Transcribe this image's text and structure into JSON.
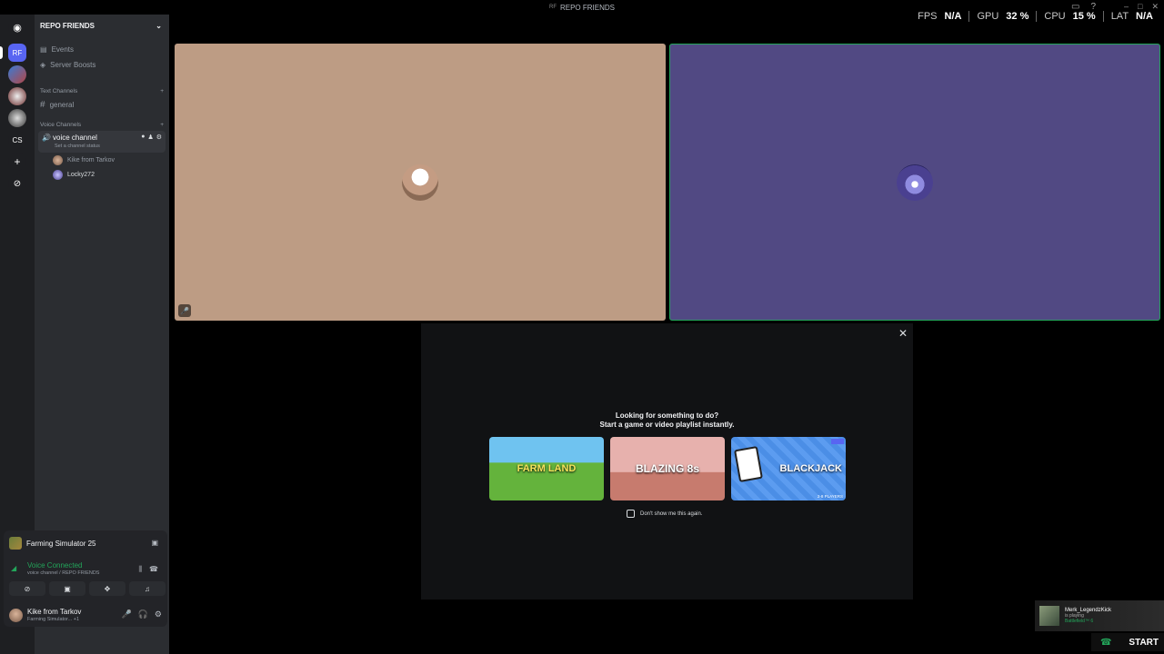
{
  "window": {
    "title": "REPO FRIENDS",
    "title_prefix": "RF"
  },
  "overlay": {
    "fps_label": "FPS",
    "fps_value": "N/A",
    "gpu_label": "GPU",
    "gpu_value": "32 %",
    "cpu_label": "CPU",
    "cpu_value": "15 %",
    "lat_label": "LAT",
    "lat_value": "N/A"
  },
  "rail": {
    "items": [
      {
        "name": "discord-home",
        "label": ""
      },
      {
        "name": "server-rf",
        "label": "RF"
      },
      {
        "name": "server-cs",
        "label": "CS"
      }
    ]
  },
  "sidebar": {
    "server_name": "REPO FRIENDS",
    "events_label": "Events",
    "boosts_label": "Server Boosts",
    "text_category": "Text Channels",
    "text_channel": "general",
    "voice_category": "Voice Channels",
    "voice_channel": "voice channel",
    "voice_status": "Set a channel status",
    "members": [
      {
        "name": "Kike from Tarkov"
      },
      {
        "name": "Locky272"
      }
    ]
  },
  "panel": {
    "game": "Farming Simulator 25",
    "voice_connected": "Voice Connected",
    "voice_location": "voice channel / REPO FRIENDS",
    "username": "Kike from Tarkov",
    "user_status": "Farming Simulator... +1"
  },
  "activity": {
    "heading1": "Looking for something to do?",
    "heading2": "Start a game or video playlist instantly.",
    "games": [
      {
        "title": "FARM LAND"
      },
      {
        "title": "BLAZING 8s"
      },
      {
        "title": "BLACKJACK",
        "footer": "2-8 PLAYERS"
      }
    ],
    "checkbox_label": "Don't show me this again."
  },
  "notification": {
    "user": "Merk_LegendzKick",
    "line2": "is playing",
    "game": "Battlefield™ 6"
  },
  "start_button": "START",
  "colors": {
    "tile1": "#bd9c84",
    "tile2": "#514983",
    "speaking_border": "#23a55a",
    "accent": "#5865f2"
  }
}
